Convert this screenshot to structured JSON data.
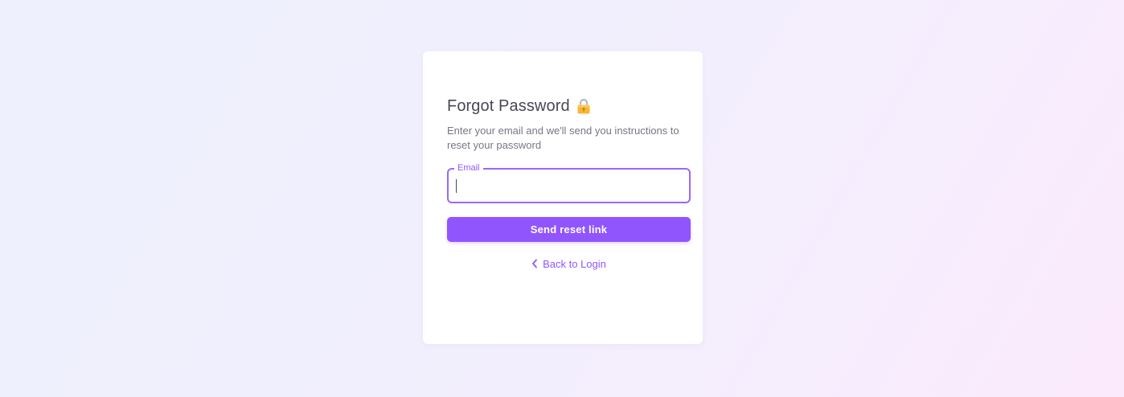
{
  "card": {
    "title": "Forgot Password",
    "title_icon": "lock-icon",
    "subtitle": "Enter your email and we'll send you instructions to reset your password"
  },
  "form": {
    "email": {
      "label": "Email",
      "value": "",
      "placeholder": ""
    },
    "submit_label": "Send reset link"
  },
  "back_link": {
    "icon": "chevron-left-icon",
    "label": "Back to Login"
  },
  "colors": {
    "primary": "#9155fd",
    "text_primary": "#4a4656",
    "text_secondary": "#7a7585",
    "card_background": "#ffffff"
  }
}
